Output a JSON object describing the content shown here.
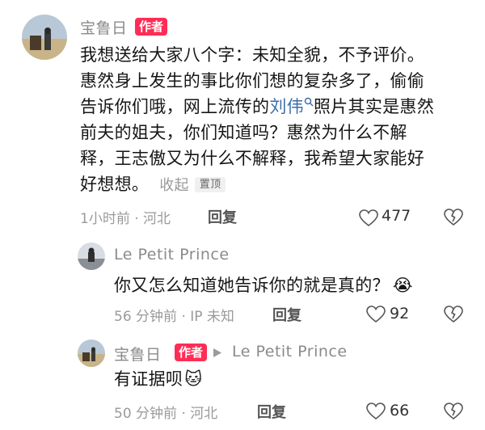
{
  "comments": [
    {
      "author": "宝鲁日",
      "badge": "作者",
      "text_before_link": "我想送给大家八个字：未知全貌，不予评价。惠然身上发生的事比你们想的复杂多了，偷偷告诉你们哦，网上流传的",
      "link_text": "刘伟",
      "text_after_link": "照片其实是惠然前夫的姐夫，你们知道吗？惠然为什么不解释，王志傲又为什么不解释，我希望大家能好好想想。",
      "collapse_label": "收起",
      "pin_label": "置顶",
      "time_location": "1小时前 · 河北",
      "reply_label": "回复",
      "likes": "477"
    },
    {
      "author": "Le Petit Prince",
      "text": "你又怎么知道她告诉你的就是真的？",
      "emoji": "😭",
      "time_location": "56 分钟前 · IP 未知",
      "reply_label": "回复",
      "likes": "92"
    },
    {
      "author": "宝鲁日",
      "badge": "作者",
      "reply_to": "Le Petit Prince",
      "text": "有证据呗",
      "emoji": "🐱",
      "time_location": "50 分钟前 · 河北",
      "reply_label": "回复",
      "likes": "66"
    }
  ],
  "colors": {
    "badge": "#ff2d55",
    "link": "#3d6ea8",
    "meta": "#9a9a9a"
  },
  "icons": [
    "heart-icon",
    "dislike-heart-icon",
    "search-icon",
    "play-triangle-icon"
  ]
}
